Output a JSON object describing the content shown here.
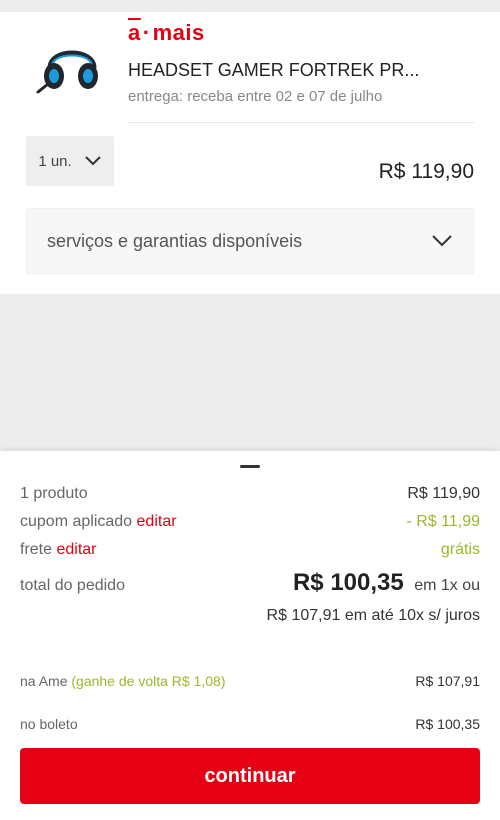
{
  "header": {
    "brand_mark": "a",
    "brand_dot": "·",
    "brand_label": "mais"
  },
  "product": {
    "title": "HEADSET GAMER FORTREK PR...",
    "delivery": "entrega: receba entre 02 e 07 de julho",
    "quantity_label": "1 un.",
    "price": "R$ 119,90",
    "services_label": "serviços e garantias disponíveis"
  },
  "summary": {
    "items_label": "1 produto",
    "items_value": "R$ 119,90",
    "coupon_label": "cupom aplicado",
    "coupon_edit": "editar",
    "coupon_value": "- R$ 11,99",
    "shipping_label": "frete",
    "shipping_edit": "editar",
    "shipping_value": "grátis",
    "total_label": "total do pedido",
    "total_amount": "R$ 100,35",
    "total_suffix": "em 1x ou",
    "installments": "R$ 107,91 em até 10x s/ juros",
    "ame_label": "na Ame",
    "ame_cashback": "(ganhe de volta R$ 1,08)",
    "ame_value": "R$ 107,91",
    "boleto_label": "no boleto",
    "boleto_value": "R$ 100,35",
    "continue_label": "continuar"
  },
  "colors": {
    "brand_red": "#e60014",
    "discount_green": "#9ab929"
  }
}
